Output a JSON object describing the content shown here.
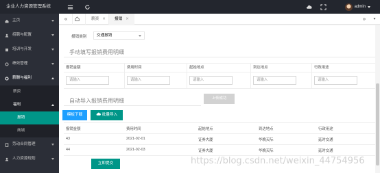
{
  "app": {
    "title": "企业人力资源管理系统"
  },
  "user": {
    "name": "admin"
  },
  "sidebar": {
    "items": [
      {
        "label": "主页"
      },
      {
        "label": "招聘与配置"
      },
      {
        "label": "培训与开发"
      },
      {
        "label": "绩效管理"
      },
      {
        "label": "薪酬与福利"
      },
      {
        "label": "劳动合同管理"
      },
      {
        "label": "人力资源规划"
      }
    ],
    "sub": [
      {
        "label": "薪资"
      },
      {
        "label": "福利"
      },
      {
        "label": "报销"
      },
      {
        "label": "商城"
      }
    ]
  },
  "tabs": [
    {
      "label": "薪资"
    },
    {
      "label": "报销"
    }
  ],
  "form": {
    "category_label": "报销类别",
    "category_value": "交通报销"
  },
  "manual": {
    "title": "手动填写报销费用明细",
    "headers": [
      "报销金额",
      "费用时间",
      "起始地点",
      "到达地点",
      "行政用途"
    ],
    "placeholder": "请输入",
    "upload_ok": "上传成功"
  },
  "auto": {
    "title": "自动导入报销费用明细",
    "template_btn": "模板下载",
    "import_btn": "批量导入",
    "headers": [
      "报销金额",
      "费用时间",
      "起始地点",
      "到达地点",
      "行政用途"
    ],
    "rows": [
      [
        "43",
        "2021-02-01",
        "证券大厦",
        "华晚天际",
        "延时交通"
      ],
      [
        "44",
        "2021-02-03",
        "证券大厦",
        "华晚天际",
        "延时交通"
      ]
    ],
    "submit_btn": "立即提交"
  },
  "watermark": "https://blog.csdn.net/weixin_44754956",
  "colors": {
    "sidebar": "#2b2e37",
    "topbar": "#23262e",
    "accent": "#009688",
    "blue": "#1e9fff"
  }
}
